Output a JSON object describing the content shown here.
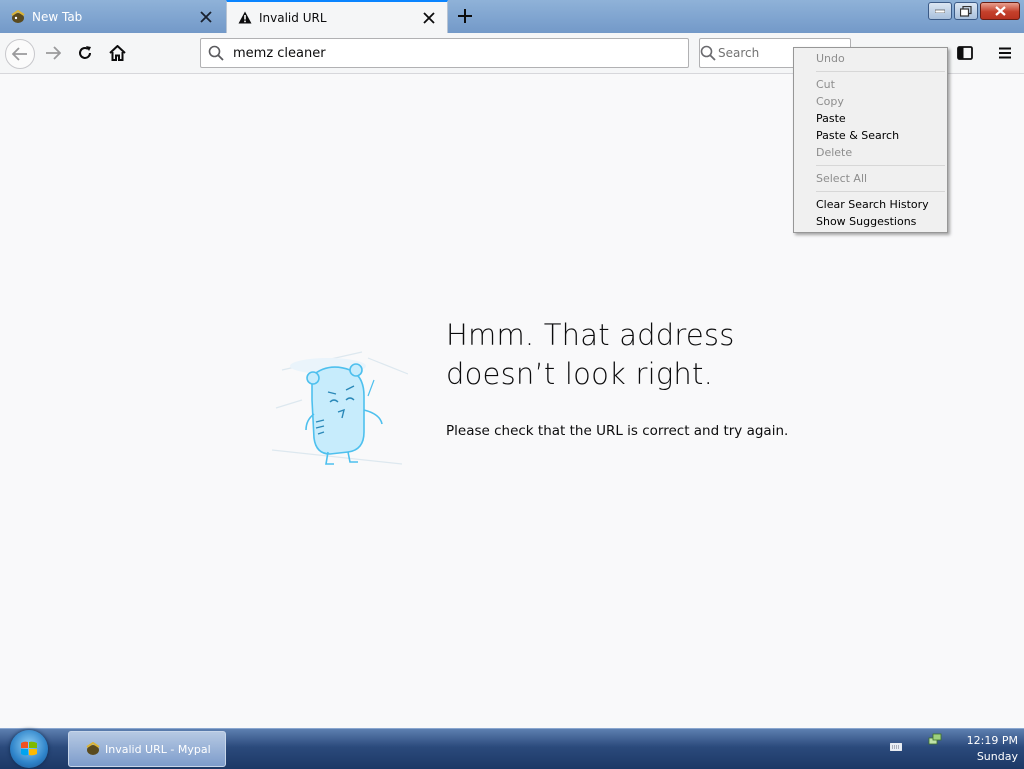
{
  "tabs": [
    {
      "label": "New Tab",
      "active": false
    },
    {
      "label": "Invalid URL",
      "active": true
    }
  ],
  "navbar": {
    "url_value": "memz cleaner",
    "search_placeholder": "Search"
  },
  "error_page": {
    "title_line1": "Hmm. That address",
    "title_line2": "doesn’t look right.",
    "description": "Please check that the URL is correct and try again."
  },
  "context_menu": {
    "items": [
      {
        "label": "Undo",
        "enabled": false
      },
      {
        "label": "Cut",
        "enabled": false
      },
      {
        "label": "Copy",
        "enabled": false
      },
      {
        "label": "Paste",
        "enabled": true
      },
      {
        "label": "Paste & Search",
        "enabled": true
      },
      {
        "label": "Delete",
        "enabled": false
      },
      {
        "label": "Select All",
        "enabled": false
      },
      {
        "label": "Clear Search History",
        "enabled": true
      },
      {
        "label": "Show Suggestions",
        "enabled": true
      }
    ]
  },
  "taskbar": {
    "window_label": "Invalid URL - Mypal",
    "time": "12:19 PM",
    "day": "Sunday"
  },
  "colors": {
    "accent": "#0a84ff",
    "page_bg": "#f9f9fa",
    "illustration": "#8fd3f4"
  },
  "icons": [
    "app-icon",
    "warning-icon",
    "close-icon",
    "plus-icon",
    "minimize-icon",
    "maximize-icon",
    "back-arrow-icon",
    "forward-arrow-icon",
    "reload-icon",
    "home-icon",
    "search-icon",
    "sidebar-icon",
    "hamburger-menu-icon",
    "windows-logo-icon",
    "keyboard-icon",
    "network-icon"
  ]
}
